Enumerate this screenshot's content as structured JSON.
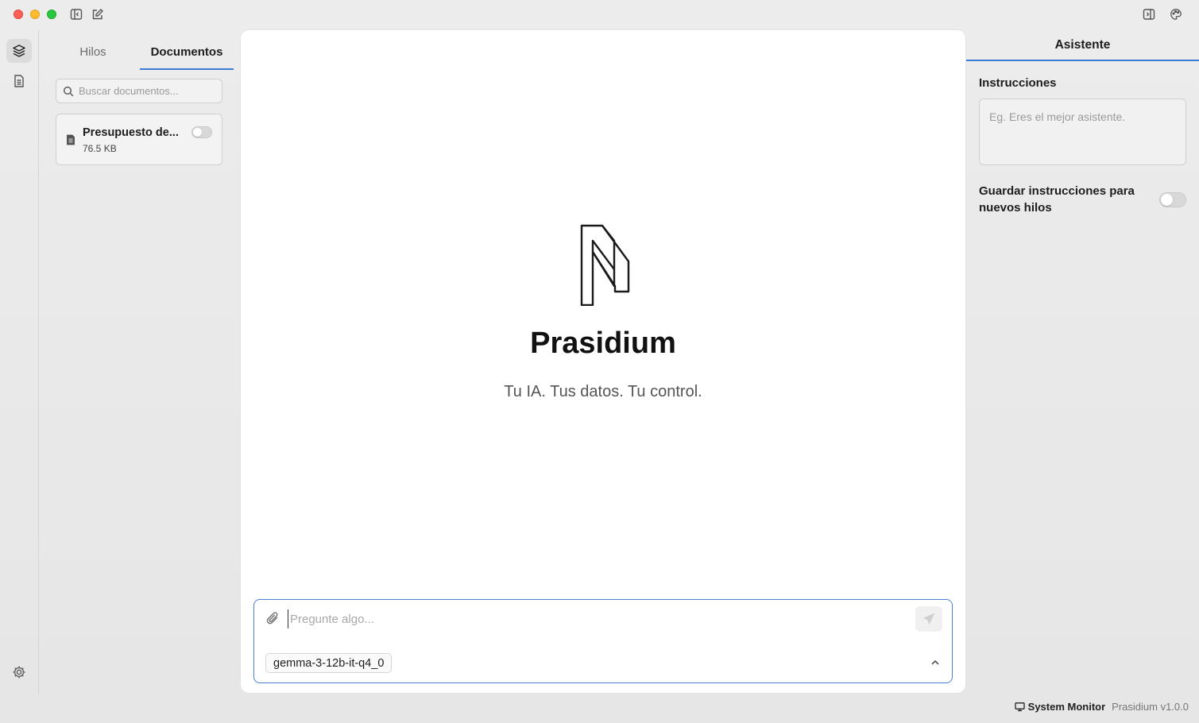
{
  "sidebar": {
    "tabs": [
      {
        "label": "Hilos",
        "active": false
      },
      {
        "label": "Documentos",
        "active": true
      }
    ],
    "search": {
      "placeholder": "Buscar documentos...",
      "value": ""
    },
    "documents": [
      {
        "title": "Presupuesto de...",
        "size": "76.5 KB",
        "enabled": false
      }
    ]
  },
  "main": {
    "app_name": "Prasidium",
    "tagline": "Tu IA. Tus datos. Tu control.",
    "composer": {
      "placeholder": "Pregunte algo...",
      "value": "",
      "model": "gemma-3-12b-it-q4_0"
    }
  },
  "assistant": {
    "tab_label": "Asistente",
    "instructions_label": "Instrucciones",
    "instructions_placeholder": "Eg. Eres el mejor asistente.",
    "save_label": "Guardar instrucciones para nuevos hilos",
    "save_enabled": false
  },
  "statusbar": {
    "system_monitor": "System Monitor",
    "version": "Prasidium v1.0.0"
  },
  "colors": {
    "accent": "#3a7bd5",
    "close": "#fe5f57",
    "minimize": "#febc2e",
    "maximize": "#28c840"
  }
}
